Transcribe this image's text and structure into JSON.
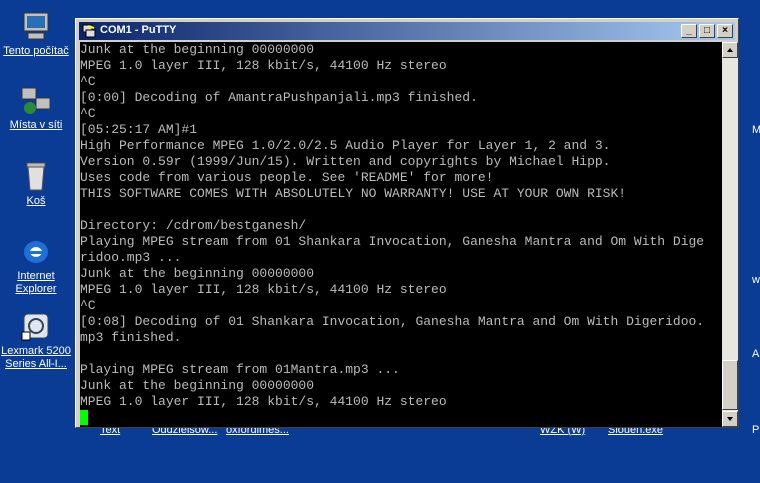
{
  "desktop": {
    "icons": [
      {
        "label": "Tento počítač",
        "icon": "computer-icon"
      },
      {
        "label": "Místa v síti",
        "icon": "network-places-icon"
      },
      {
        "label": "Koš",
        "icon": "recycle-bin-icon"
      },
      {
        "label": "Internet Explorer",
        "icon": "internet-explorer-icon"
      },
      {
        "label": "Lexmark 5200 Series All-I...",
        "icon": "printer-shortcut-icon"
      }
    ],
    "background_labels": [
      "Text",
      "Oddzielsow...",
      "oxfordimes...",
      "WZK (W)",
      "Slouen.exe"
    ],
    "edge_letters": [
      "M",
      "w",
      "A",
      "P"
    ]
  },
  "window": {
    "title": "COM1 - PuTTY",
    "minimize_symbol": "_",
    "maximize_symbol": "□",
    "close_symbol": "×"
  },
  "terminal": {
    "lines": [
      "Junk at the beginning 00000000",
      "MPEG 1.0 layer III, 128 kbit/s, 44100 Hz stereo",
      "^C",
      "[0:00] Decoding of AmantraPushpanjali.mp3 finished.",
      "^C",
      "[05:25:17 AM]#1",
      "High Performance MPEG 1.0/2.0/2.5 Audio Player for Layer 1, 2 and 3.",
      "Version 0.59r (1999/Jun/15). Written and copyrights by Michael Hipp.",
      "Uses code from various people. See 'README' for more!",
      "THIS SOFTWARE COMES WITH ABSOLUTELY NO WARRANTY! USE AT YOUR OWN RISK!",
      "",
      "Directory: /cdrom/bestganesh/",
      "Playing MPEG stream from 01 Shankara Invocation, Ganesha Mantra and Om With Dige",
      "ridoo.mp3 ...",
      "Junk at the beginning 00000000",
      "MPEG 1.0 layer III, 128 kbit/s, 44100 Hz stereo",
      "^C",
      "[0:08] Decoding of 01 Shankara Invocation, Ganesha Mantra and Om With Digeridoo.",
      "mp3 finished.",
      "",
      "Playing MPEG stream from 01Mantra.mp3 ...",
      "Junk at the beginning 00000000",
      "MPEG 1.0 layer III, 128 kbit/s, 44100 Hz stereo"
    ]
  }
}
